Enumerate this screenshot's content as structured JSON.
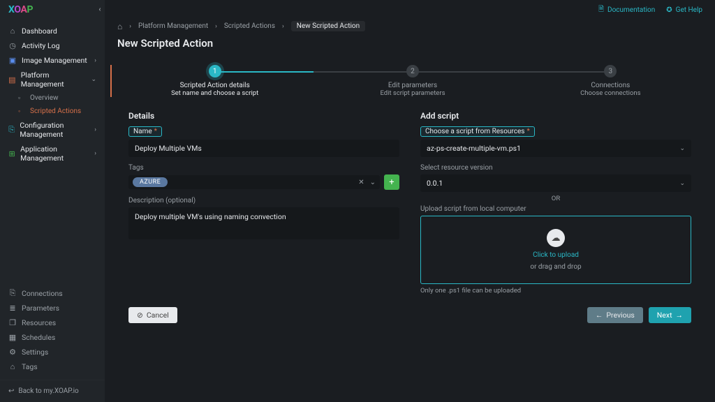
{
  "brand": {
    "l1": "X",
    "l2": "O",
    "l3": "A",
    "l4": "P"
  },
  "topbar": {
    "docs": "Documentation",
    "help": "Get Help"
  },
  "crumbs": {
    "c1": "Platform Management",
    "c2": "Scripted Actions",
    "c3": "New Scripted Action"
  },
  "page_title": "New Scripted Action",
  "sidebar": {
    "dashboard": "Dashboard",
    "activity": "Activity Log",
    "image": "Image Management",
    "platform": "Platform Management",
    "overview": "Overview",
    "scripted": "Scripted Actions",
    "config": "Configuration Management",
    "app": "Application Management",
    "connections": "Connections",
    "parameters": "Parameters",
    "resources": "Resources",
    "schedules": "Schedules",
    "settings": "Settings",
    "tags": "Tags",
    "back": "Back to my.XOAP.io"
  },
  "steps": [
    {
      "num": "1",
      "title": "Scripted Action details",
      "sub": "Set name and choose a script"
    },
    {
      "num": "2",
      "title": "Edit parameters",
      "sub": "Edit script parameters"
    },
    {
      "num": "3",
      "title": "Connections",
      "sub": "Choose connections"
    }
  ],
  "details": {
    "section": "Details",
    "name_label": "Name",
    "name_value": "Deploy Multiple VMs",
    "tags_label": "Tags",
    "tag_value": "AZURE",
    "desc_label": "Description (optional)",
    "desc_value": "Deploy multiple VM's using naming convection"
  },
  "script": {
    "section": "Add script",
    "choose_label": "Choose a script from Resources",
    "script_value": "az-ps-create-multiple-vm.ps1",
    "version_label": "Select resource version",
    "version_value": "0.0.1",
    "or": "OR",
    "upload_label": "Upload script from local computer",
    "click": "Click to upload",
    "drag": "or drag and drop",
    "hint": "Only one .ps1 file can be uploaded"
  },
  "footer": {
    "cancel": "Cancel",
    "prev": "Previous",
    "next": "Next"
  }
}
